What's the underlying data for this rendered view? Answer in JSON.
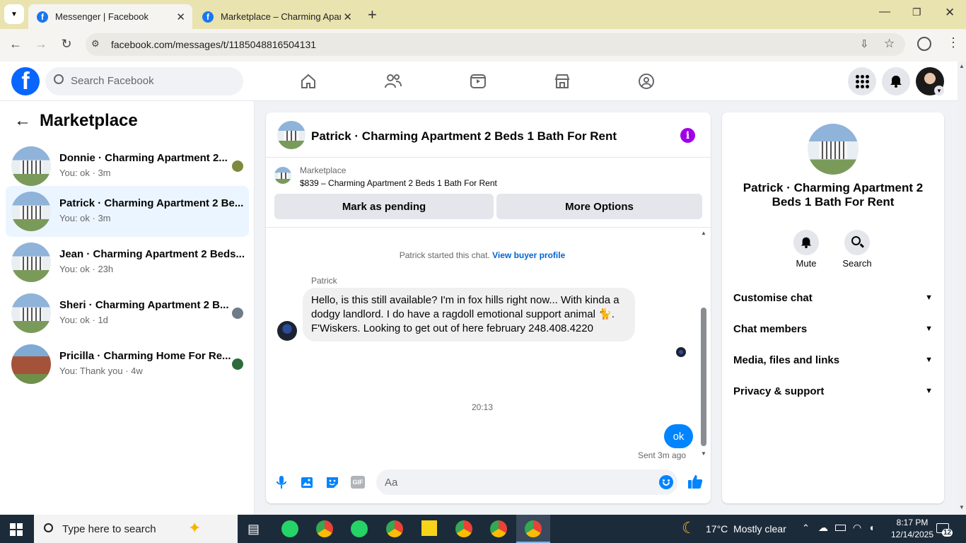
{
  "browser": {
    "tabs": [
      {
        "title": "Messenger | Facebook"
      },
      {
        "title": "Marketplace – Charming Apartm"
      }
    ],
    "url": "facebook.com/messages/t/1185048816504131"
  },
  "fb_header": {
    "search_placeholder": "Search Facebook"
  },
  "sidebar": {
    "title": "Marketplace",
    "conversations": [
      {
        "name": "Donnie · Charming Apartment 2...",
        "sub": "You: ok · 3m"
      },
      {
        "name": "Patrick · Charming Apartment 2 Be...",
        "sub": "You: ok · 3m"
      },
      {
        "name": "Jean · Charming Apartment 2 Beds...",
        "sub": "You: ok · 23h"
      },
      {
        "name": "Sheri · Charming Apartment 2 B...",
        "sub": "You: ok · 1d"
      },
      {
        "name": "Pricilla · Charming Home For Re...",
        "sub": "You: Thank you · 4w"
      }
    ]
  },
  "chat": {
    "title": "Patrick · Charming Apartment 2 Beds 1 Bath For Rent",
    "listing_label": "Marketplace",
    "listing_detail": "$839 – Charming Apartment 2 Beds 1 Bath For Rent",
    "btn_pending": "Mark as pending",
    "btn_more": "More Options",
    "started_text": "Patrick started this chat.",
    "buyer_profile_link": "View buyer profile",
    "sender_name": "Patrick",
    "message_text": "Hello, is this still available? I'm in fox hills right now... With kinda a dodgy landlord. I do have a  ragdoll emotional support animal 🐈. F'Wiskers. Looking to get out of here february 248.408.4220",
    "timestamp": "20:13",
    "my_message": "ok",
    "sent_status": "Sent 3m ago",
    "composer_placeholder": "Aa"
  },
  "right_panel": {
    "name": "Patrick · Charming Apartment 2 Beds 1 Bath For Rent",
    "mute_label": "Mute",
    "search_label": "Search",
    "sections": [
      "Customise chat",
      "Chat members",
      "Media, files and links",
      "Privacy & support"
    ]
  },
  "taskbar": {
    "search_placeholder": "Type here to search",
    "weather": "17°C  Mostly clear",
    "time": "8:17 PM",
    "date": "12/14/2025",
    "notifications": "12"
  }
}
